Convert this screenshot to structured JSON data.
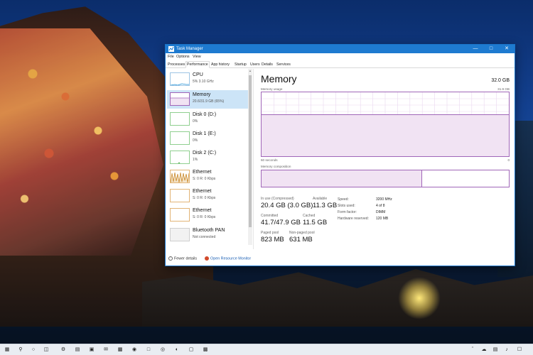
{
  "window": {
    "title": "Task Manager"
  },
  "menu": [
    "File",
    "Options",
    "View"
  ],
  "tabs": [
    "Processes",
    "Performance",
    "App history",
    "Startup",
    "Users",
    "Details",
    "Services"
  ],
  "active_tab": "Performance",
  "sidebar": {
    "items": [
      {
        "name": "CPU",
        "sub": "5% 3.10 GHz",
        "color": "#1e90d6"
      },
      {
        "name": "Memory",
        "sub": "20.6/31.9 GB (65%)",
        "color": "#a066b8"
      },
      {
        "name": "Disk 0 (D:)",
        "sub": "0%",
        "color": "#4cae4c"
      },
      {
        "name": "Disk 1 (E:)",
        "sub": "0%",
        "color": "#4cae4c"
      },
      {
        "name": "Disk 2 (C:)",
        "sub": "1%",
        "color": "#4cae4c"
      },
      {
        "name": "Ethernet",
        "sub": "S: 0 R: 0 Kbps",
        "color": "#c98a2e"
      },
      {
        "name": "Ethernet",
        "sub": "S: 0 R: 0 Kbps",
        "color": "#c98a2e"
      },
      {
        "name": "Ethernet",
        "sub": "S: 0 R: 0 Kbps",
        "color": "#c98a2e"
      },
      {
        "name": "Bluetooth PAN",
        "sub": "Not connected",
        "color": "#bbbbbb"
      }
    ]
  },
  "footer": {
    "fewer_details": "Fewer details",
    "open_resource_monitor": "Open Resource Monitor"
  },
  "memory": {
    "title": "Memory",
    "total": "32.0 GB",
    "usage_label": "Memory usage",
    "usage_max": "31.9 GB",
    "time_label": "60 seconds",
    "time_end": "0",
    "usage_level_fraction": 0.65,
    "composition_label": "Memory composition",
    "composition_used_fraction": 0.65,
    "stats": {
      "in_use_label": "In use (Compressed)",
      "in_use": "20.4 GB (3.0 GB)",
      "available_label": "Available",
      "available": "11.3 GB",
      "committed_label": "Committed",
      "committed": "41.7/47.9 GB",
      "cached_label": "Cached",
      "cached": "11.5 GB",
      "paged_label": "Paged pool",
      "paged": "823 MB",
      "nonpaged_label": "Non-paged pool",
      "nonpaged": "631 MB"
    },
    "details": [
      {
        "k": "Speed:",
        "v": "3200 MHz"
      },
      {
        "k": "Slots used:",
        "v": "4 of 8"
      },
      {
        "k": "Form factor:",
        "v": "DIMM"
      },
      {
        "k": "Hardware reserved:",
        "v": "120 MB"
      }
    ]
  },
  "colors": {
    "accent": "#1e7ad0",
    "memory": "#a066b8",
    "selected": "#cce4f7"
  }
}
